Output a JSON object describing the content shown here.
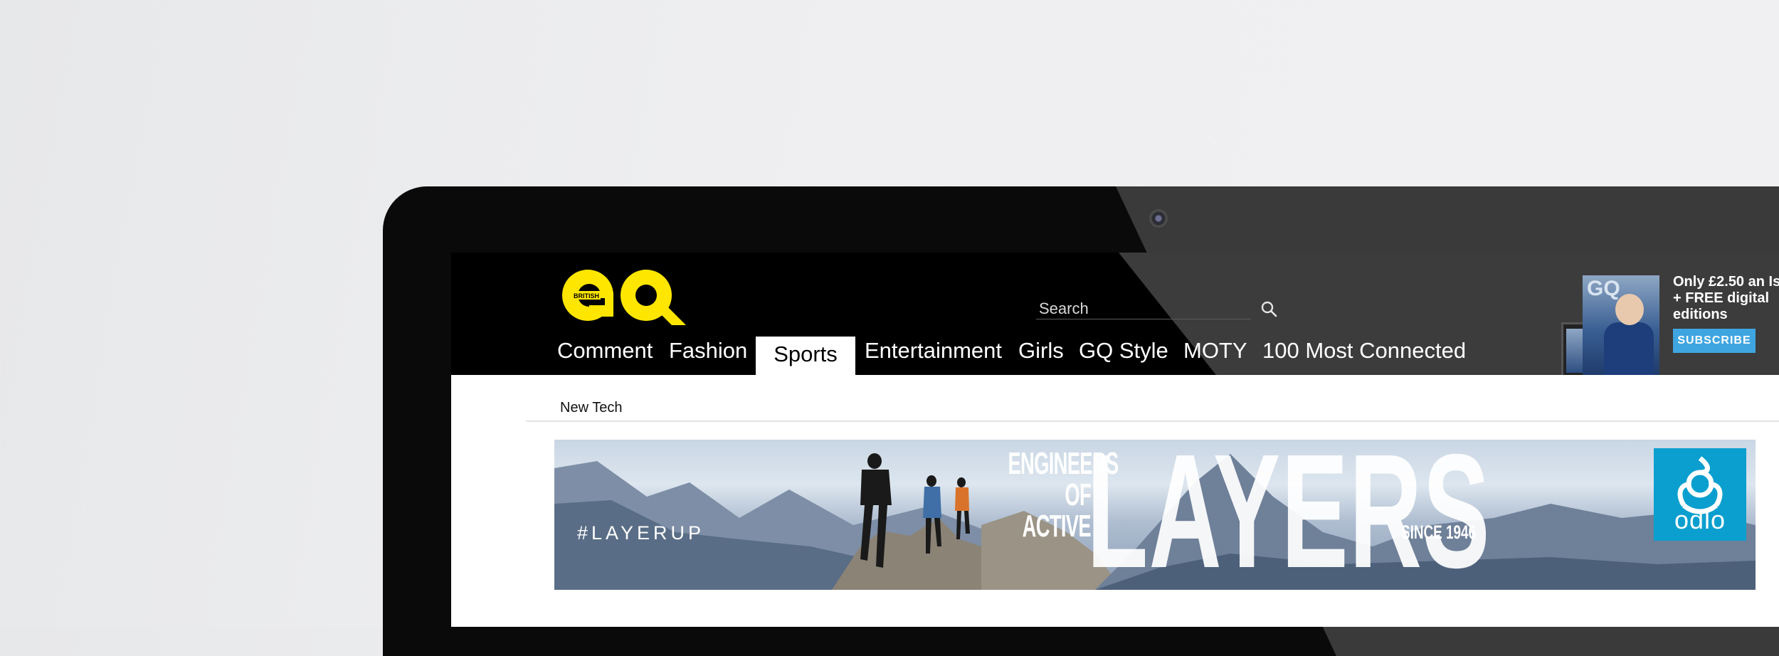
{
  "site": {
    "logo": {
      "text": "GQ",
      "subtext": "BRITISH",
      "color": "#ffe600"
    },
    "search": {
      "placeholder": "Search",
      "icon": "search-icon"
    },
    "nav": [
      {
        "label": "Comment",
        "active": false
      },
      {
        "label": "Fashion",
        "active": false
      },
      {
        "label": "Sports",
        "active": true
      },
      {
        "label": "Entertainment",
        "active": false
      },
      {
        "label": "Girls",
        "active": false
      },
      {
        "label": "GQ Style",
        "active": false
      },
      {
        "label": "MOTY",
        "active": false
      },
      {
        "label": "100 Most Connected",
        "active": false
      }
    ],
    "subnav": {
      "link": "New Tech"
    },
    "promo": {
      "line1": "Only £2.50 an Is",
      "line2": "+ FREE digital",
      "line3": "editions",
      "button": "SUBSCRIBE",
      "button_color": "#3fa5e0"
    }
  },
  "banner_ad": {
    "hashtag": "#LAYERUP",
    "tagline": [
      "ENGINEERS",
      "OF",
      "ACTIVE"
    ],
    "headline": "LAYERS",
    "since": "SINCE 1946",
    "brand": "odlo",
    "brand_color": "#0a9fcf"
  }
}
